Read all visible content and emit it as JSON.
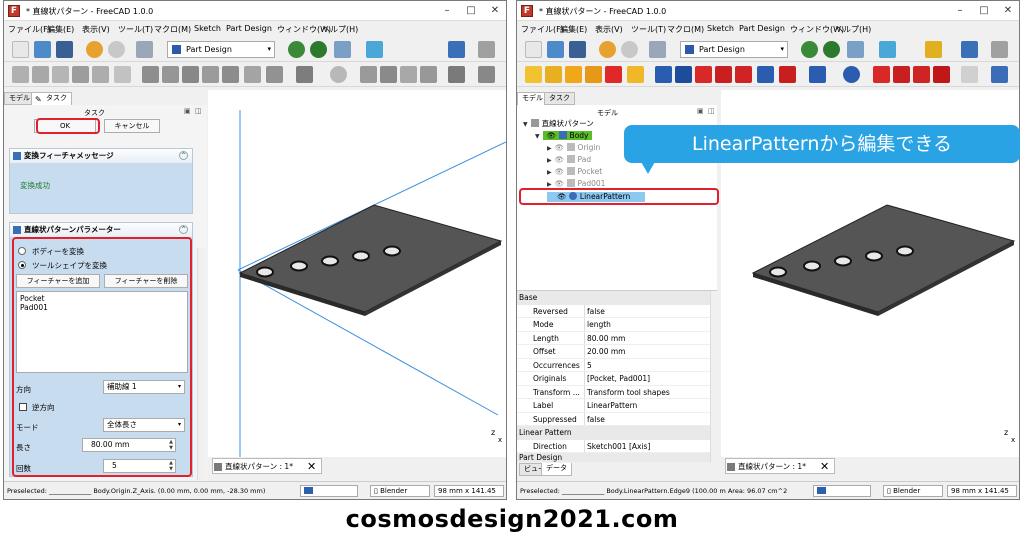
{
  "left": {
    "title": "* 直線状パターン - FreeCAD 1.0.0",
    "menu": [
      "ファイル(F)",
      "編集(E)",
      "表示(V)",
      "ツール(T)",
      "マクロ(M)",
      "Sketch",
      "Part Design",
      "ウィンドウ(W)",
      "ヘルプ(H)"
    ],
    "workbench": "Part Design",
    "tabs": [
      "モデル",
      "タスク"
    ],
    "panel_header": "タスク",
    "ok_label": "OK",
    "cancel_label": "キャンセル",
    "msg_title": "変換フィーチャメッセージ",
    "msg_text": "変換成功",
    "param_title": "直線状パターンパラメーター",
    "radio_body": "ボディーを変換",
    "radio_tool": "ツールシェイプを変換",
    "add_feature": "フィーチャーを追加",
    "remove_feature": "フィーチャーを削除",
    "features": [
      "Pocket",
      "Pad001"
    ],
    "direction_label": "方向",
    "direction_value": "補助線 1",
    "reverse_label": "逆方向",
    "mode_label": "モード",
    "mode_value": "全体長さ",
    "length_label": "長さ",
    "length_value": "80.00 mm",
    "count_label": "回数",
    "count_value": "5",
    "doc_tab": "直線状パターン : 1*",
    "status_preselect": "Preselected: _____________ Body.Origin.Z_Axis. (0.00 mm, 0.00 mm, -28.30 mm)",
    "nav_style": "Blender",
    "dims": "98 mm x 141.45"
  },
  "right": {
    "title": "* 直線状パターン - FreeCAD 1.0.0",
    "menu": [
      "ファイル(F)",
      "編集(E)",
      "表示(V)",
      "ツール(T)",
      "マクロ(M)",
      "Sketch",
      "Part Design",
      "ウィンドウ(W)",
      "ヘルプ(H)"
    ],
    "workbench": "Part Design",
    "tabs": [
      "モデル",
      "タスク"
    ],
    "panel_header": "モデル",
    "tree": {
      "doc": "直線状パターン",
      "body": "Body",
      "origin": "Origin",
      "pad": "Pad",
      "pocket": "Pocket",
      "pad001": "Pad001",
      "linear": "LinearPattern"
    },
    "props_group_base": "Base",
    "props": [
      {
        "name": "Reversed",
        "value": "false"
      },
      {
        "name": "Mode",
        "value": "length"
      },
      {
        "name": "Length",
        "value": "80.00 mm"
      },
      {
        "name": "Offset",
        "value": "20.00 mm"
      },
      {
        "name": "Occurrences",
        "value": "5"
      },
      {
        "name": "Originals",
        "value": "[Pocket, Pad001]"
      },
      {
        "name": "Transform ...",
        "value": "Transform tool shapes"
      },
      {
        "name": "Label",
        "value": "LinearPattern"
      },
      {
        "name": "Suppressed",
        "value": "false"
      }
    ],
    "props_group_linear": "Linear Pattern",
    "direction_name": "Direction",
    "direction_value": "Sketch001 [Axis]",
    "props_group_partial": "Part Design",
    "bottom_tabs": [
      "ビュー",
      "データ"
    ],
    "doc_tab": "直線状パターン : 1*",
    "status_preselect": "Preselected: _____________ Body.LinearPattern.Edge9 (100.00 m  Area: 96.07 cm^2",
    "nav_style": "Blender",
    "dims": "98 mm x 141.45"
  },
  "callout": "LinearPatternから編集できる",
  "watermark": "cosmosdesign2021.com"
}
